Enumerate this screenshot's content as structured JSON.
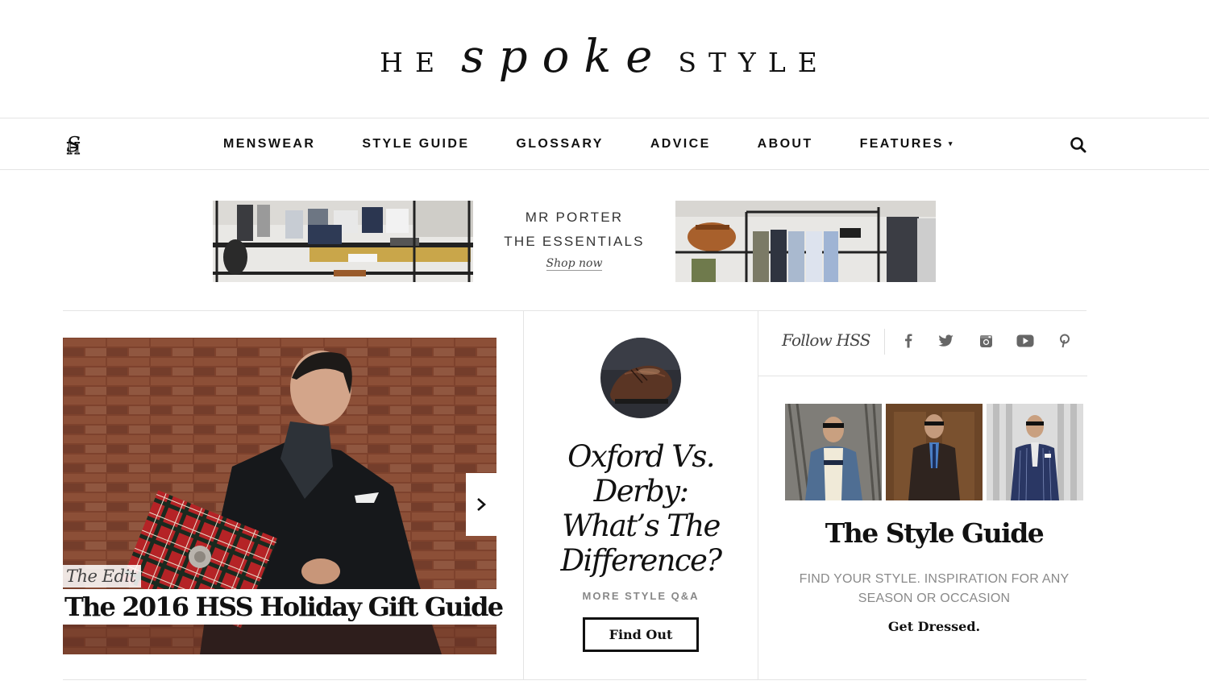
{
  "header": {
    "logo_left": "HE",
    "logo_script": "spoke",
    "logo_right": "STYLE"
  },
  "nav": {
    "items": [
      {
        "label": "MENSWEAR"
      },
      {
        "label": "STYLE GUIDE"
      },
      {
        "label": "GLOSSARY"
      },
      {
        "label": "ADVICE"
      },
      {
        "label": "ABOUT"
      },
      {
        "label": "FEATURES",
        "has_dropdown": true
      }
    ],
    "dropdown_caret": "▾",
    "search_icon": "search-icon",
    "monogram_icon": "hss-monogram-icon"
  },
  "ad": {
    "brand": "MR PORTER",
    "title": "THE ESSENTIALS",
    "cta": "Shop now"
  },
  "hero": {
    "kicker": "The Edit",
    "title": "The 2016 HSS Holiday Gift Guide",
    "next_icon": "chevron-right-icon"
  },
  "feature": {
    "title": "Oxford Vs. Derby: What’s The Difference?",
    "more": "MORE STYLE Q&A",
    "button": "Find Out"
  },
  "follow": {
    "label": "Follow HSS",
    "icons": [
      "facebook-icon",
      "twitter-icon",
      "instagram-icon",
      "youtube-icon",
      "pinterest-icon"
    ]
  },
  "style_guide": {
    "title": "The Style Guide",
    "description": "FIND YOUR STYLE. INSPIRATION FOR ANY SEASON OR OCCASION",
    "link": "Get Dressed",
    "link_suffix": "."
  },
  "colors": {
    "text": "#111111",
    "muted": "#8a8a8a",
    "rule": "#e4e4e4",
    "social_icon": "#666666"
  }
}
